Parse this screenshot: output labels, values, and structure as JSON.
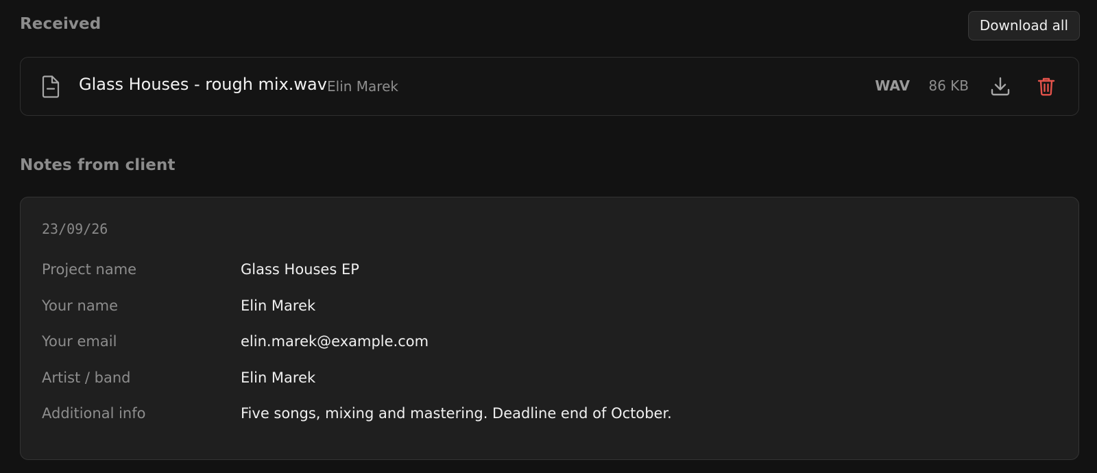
{
  "received": {
    "title": "Received",
    "download_all_label": "Download all",
    "files": [
      {
        "name": "Glass Houses - rough mix.wav",
        "owner": "Elin Marek",
        "type": "WAV",
        "size": "86 KB",
        "icon": "file-icon"
      }
    ],
    "actions": {
      "download_icon": "download-icon",
      "delete_icon": "trash-icon",
      "delete_color": "#e5534b"
    }
  },
  "notes": {
    "title": "Notes from client",
    "date": "23/09/26",
    "rows": [
      {
        "label": "Project name",
        "value": "Glass Houses EP"
      },
      {
        "label": "Your name",
        "value": "Elin Marek"
      },
      {
        "label": "Your email",
        "value": "elin.marek@example.com"
      },
      {
        "label": "Artist / band",
        "value": "Elin Marek"
      },
      {
        "label": "Additional info",
        "value": "Five songs, mixing and mastering. Deadline end of October."
      }
    ]
  }
}
